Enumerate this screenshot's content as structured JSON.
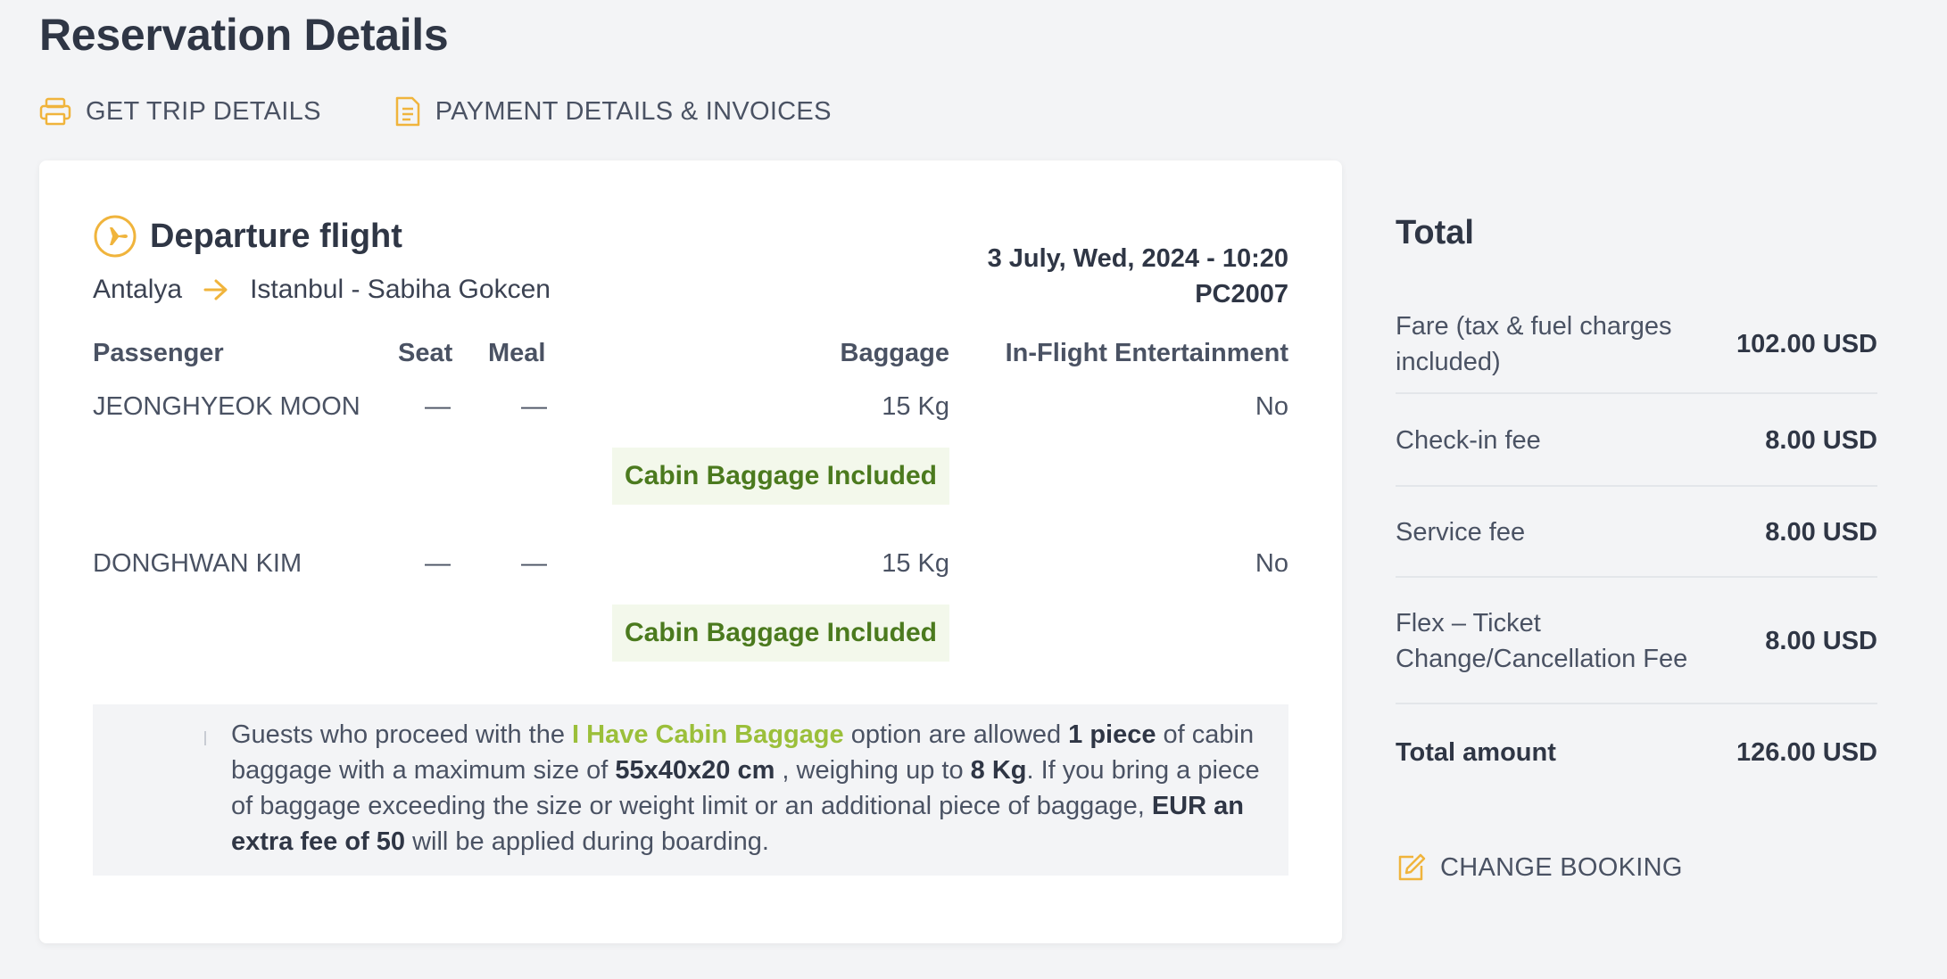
{
  "page": {
    "title": "Reservation Details"
  },
  "actions": {
    "trip_details": "GET TRIP DETAILS",
    "payment": "PAYMENT DETAILS & INVOICES"
  },
  "flight": {
    "title": "Departure flight",
    "origin": "Antalya",
    "destination": "Istanbul - Sabiha Gokcen",
    "datetime": "3 July, Wed, 2024 - 10:20",
    "flight_no": "PC2007"
  },
  "table": {
    "headers": {
      "passenger": "Passenger",
      "seat": "Seat",
      "meal": "Meal",
      "baggage": "Baggage",
      "ife": "In-Flight Entertainment"
    },
    "rows": [
      {
        "passenger": "JEONGHYEOK MOON",
        "seat": "—",
        "meal": "—",
        "baggage": "15 Kg",
        "ife": "No",
        "badge": "Cabin Baggage Included"
      },
      {
        "passenger": "DONGHWAN KIM",
        "seat": "—",
        "meal": "—",
        "baggage": "15 Kg",
        "ife": "No",
        "badge": "Cabin Baggage Included"
      }
    ]
  },
  "note": {
    "t1": "Guests who proceed with the ",
    "hl": "I Have Cabin Baggage",
    "t2": " option are allowed ",
    "b1": "1 piece",
    "t3": " of cabin baggage with a maximum size of ",
    "b2": "55x40x20 cm",
    "t4": " , weighing up to ",
    "b3": "8 Kg",
    "t5": ". If you bring a piece of baggage exceeding the size or weight limit or an additional piece of baggage, ",
    "b4": "EUR an extra fee of 50",
    "t6": " will be applied during boarding."
  },
  "total": {
    "title": "Total",
    "items": [
      {
        "label": "Fare (tax & fuel charges included)",
        "value": "102.00 USD"
      },
      {
        "label": "Check-in fee",
        "value": "8.00 USD"
      },
      {
        "label": "Service fee",
        "value": "8.00 USD"
      },
      {
        "label": "Flex – Ticket Change/Cancellation Fee",
        "value": "8.00 USD"
      }
    ],
    "total_label": "Total amount",
    "total_value": "126.00 USD",
    "change_booking": "CHANGE BOOKING"
  },
  "colors": {
    "accent": "#f0b43c",
    "badge_bg": "#f3f8eb",
    "badge_text": "#4b7a1e",
    "highlight": "#9bbf3a"
  }
}
